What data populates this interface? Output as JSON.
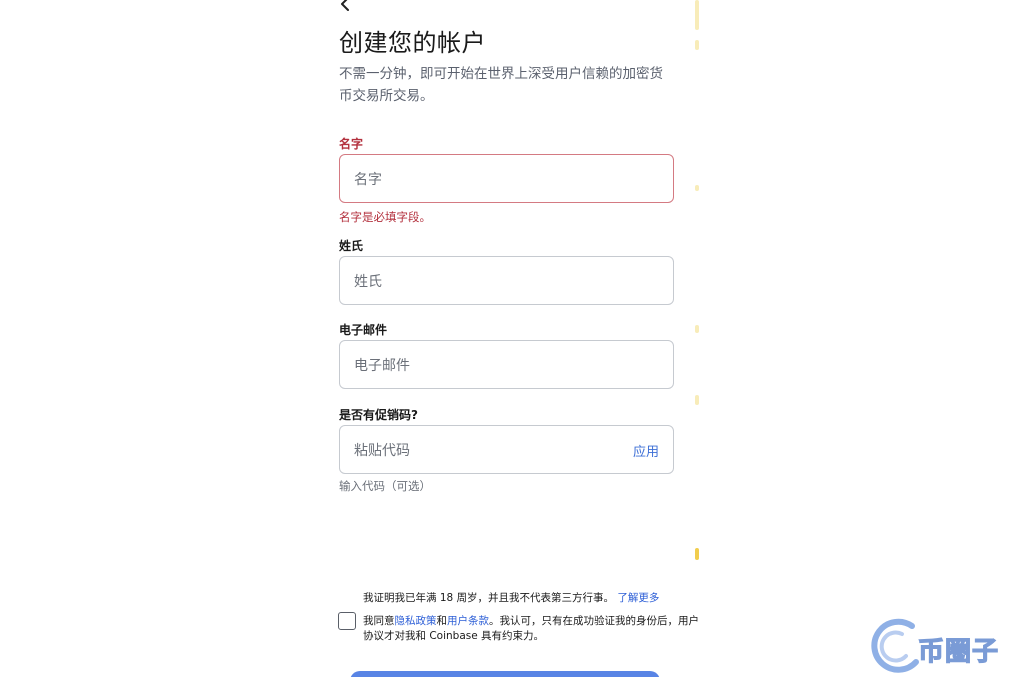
{
  "header": {
    "back_icon": "chevron-left-icon",
    "title": "创建您的帐户",
    "subtitle": "不需一分钟，即可开始在世界上深受用户信赖的加密货币交易所交易。"
  },
  "form": {
    "first_name": {
      "label": "名字",
      "placeholder": "名字",
      "error": "名字是必填字段。"
    },
    "last_name": {
      "label": "姓氏",
      "placeholder": "姓氏"
    },
    "email": {
      "label": "电子邮件",
      "placeholder": "电子邮件"
    },
    "promo": {
      "label": "是否有促销码?",
      "placeholder": "粘贴代码",
      "apply": "应用",
      "hint": "输入代码（可选）"
    }
  },
  "agreement": {
    "age_text": "我证明我已年满 18 周岁，并且我不代表第三方行事。",
    "learn_more": "了解更多",
    "terms_prefix": "我同意",
    "privacy_policy": "隐私政策",
    "and": "和",
    "user_terms": "用户条款",
    "terms_suffix": "。我认可，只有在成功验证我的身份后，用户协议才对我和 Coinbase 具有约束力。"
  },
  "watermark": {
    "text": "币圈子"
  },
  "colors": {
    "error": "#b3303d",
    "link": "#2c5ed6",
    "accent": "#3b6fe0"
  }
}
